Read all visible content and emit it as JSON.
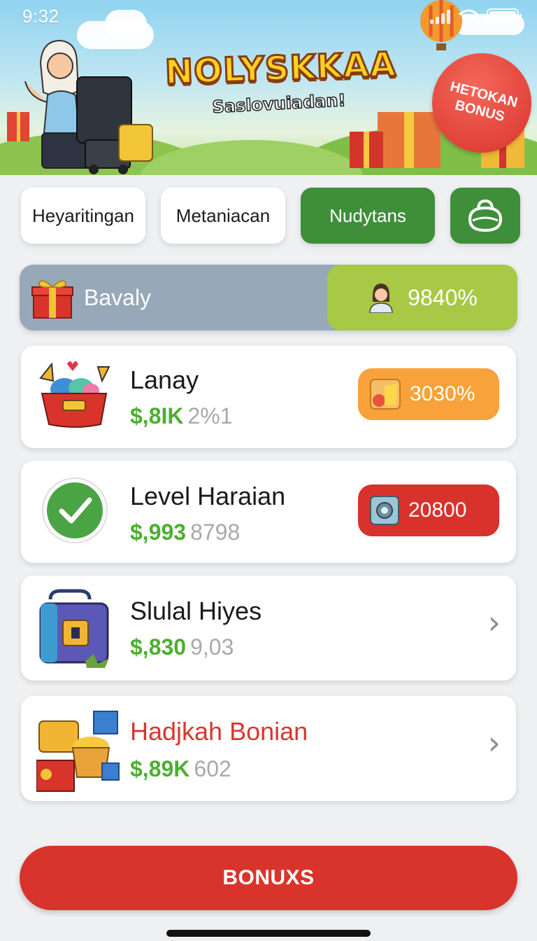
{
  "status": {
    "time": "9:32"
  },
  "hero": {
    "title": "NOLYSKKAA",
    "subtitle": "Saslovuiadan!",
    "badge": "HETOKAN BONUS"
  },
  "tabs": [
    {
      "label": "Heyaritingan",
      "active": false
    },
    {
      "label": "Metaniacan",
      "active": false
    },
    {
      "label": "Nudytans",
      "active": true
    }
  ],
  "tab_icon": "bag-icon",
  "balance": {
    "label": "Bavaly",
    "percent": "9840%"
  },
  "items": [
    {
      "title": "Lanay",
      "amount": "$,8IK",
      "sub": "2%1",
      "pill": "3030%",
      "icon": "basket-icon"
    },
    {
      "title": "Level Haraian",
      "amount": "$,993",
      "sub": "8798",
      "pill": "20800",
      "icon": "check-icon"
    },
    {
      "title": "Slulal Hiyes",
      "amount": "$,830",
      "sub": "9,03",
      "icon": "chest-icon"
    },
    {
      "title": "Hadjkah Bonian",
      "amount": "$,89K",
      "sub": "602",
      "icon": "gift-pile-icon"
    }
  ],
  "cta": {
    "label": "BONUXS"
  },
  "colors": {
    "green": "#3f8e3a",
    "red": "#d9342b",
    "orange": "#f7a23a",
    "lime": "#a7c945",
    "amount_green": "#4caf30"
  }
}
